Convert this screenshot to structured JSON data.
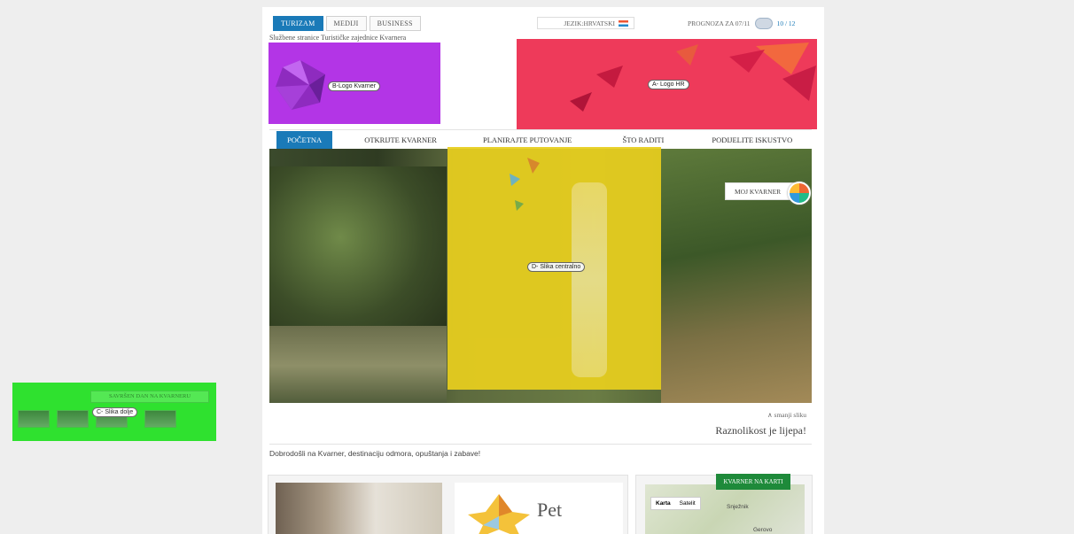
{
  "top_tabs": [
    "TURIZAM",
    "MEDIJI",
    "BUSINESS"
  ],
  "subtitle": "Službene stranice Turističke zajednice Kvarnera",
  "language_selector": "JEZIK:HRVATSKI",
  "weather": {
    "label": "PROGNOZA ZA 07/11",
    "temp": "10 / 12"
  },
  "logo_overlay_label": "B-Logo Kvarner",
  "hr_overlay_label": "A- Logo HR",
  "nav": [
    "POČETNA",
    "OTKRIJTE KVARNER",
    "PLANIRAJTE PUTOVANJE",
    "ŠTO RADITI",
    "PODIJELITE ISKUSTVO"
  ],
  "central_image_label": "D- Slika centralno",
  "moj_kvarner": "MOJ KVARNER",
  "bottom_image_label": "C- Slika dolje",
  "savrsen_dan": "SAVRŠEN DAN NA KVARNERU",
  "smanji_sliku": "smanji sliku",
  "tagline": "Raznolikost je lijepa!",
  "welcome": "Dobrodošli na Kvarner, destinaciju odmora, opuštanja i zabave!",
  "pet": "Pet",
  "map": {
    "title": "KVARNER NA KARTI",
    "tabs": [
      "Karta",
      "Satelit"
    ],
    "places": [
      "Snježnik",
      "Gerovo"
    ]
  }
}
